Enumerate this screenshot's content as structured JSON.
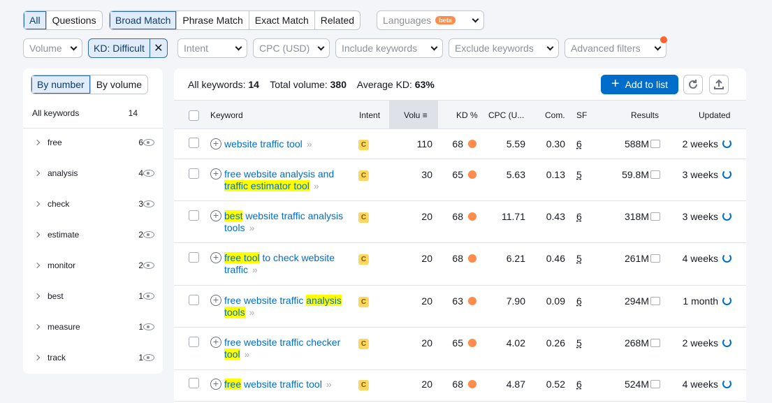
{
  "tabs_type": [
    "All",
    "Questions"
  ],
  "tabs_match": [
    "Broad Match",
    "Phrase Match",
    "Exact Match",
    "Related"
  ],
  "languages": {
    "label": "Languages",
    "badge": "beta"
  },
  "filters": {
    "volume": "Volume",
    "kd": "KD: Difficult",
    "intent": "Intent",
    "cpc": "CPC (USD)",
    "include": "Include keywords",
    "exclude": "Exclude keywords",
    "advanced": "Advanced filters"
  },
  "left": {
    "toggle": [
      "By number",
      "By volume"
    ],
    "all_label": "All keywords",
    "all_count": "14",
    "groups": [
      {
        "name": "free",
        "count": "6"
      },
      {
        "name": "analysis",
        "count": "4"
      },
      {
        "name": "check",
        "count": "3"
      },
      {
        "name": "estimate",
        "count": "2"
      },
      {
        "name": "monitor",
        "count": "2"
      },
      {
        "name": "best",
        "count": "1"
      },
      {
        "name": "measure",
        "count": "1"
      },
      {
        "name": "track",
        "count": "1"
      }
    ]
  },
  "summary": {
    "all_label": "All keywords:",
    "all_value": "14",
    "vol_label": "Total volume:",
    "vol_value": "380",
    "kd_label": "Average KD:",
    "kd_value": "63%"
  },
  "add_to_list": "Add to list",
  "columns": [
    "Keyword",
    "Intent",
    "Volu",
    "KD %",
    "CPC (U...",
    "Com.",
    "SF",
    "Results",
    "Updated"
  ],
  "rows": [
    {
      "kw": [
        [
          "website traffic tool",
          false
        ]
      ],
      "intent": "C",
      "volume": "110",
      "kd": "68",
      "cpc": "5.59",
      "com": "0.30",
      "sf": "6",
      "results": "588M",
      "updated": "2 weeks"
    },
    {
      "kw": [
        [
          "free website analysis and ",
          false
        ],
        [
          "traffic estimator tool",
          true
        ]
      ],
      "intent": "C",
      "volume": "30",
      "kd": "65",
      "cpc": "5.63",
      "com": "0.13",
      "sf": "5",
      "results": "59.8M",
      "updated": "3 weeks"
    },
    {
      "kw": [
        [
          "best",
          true
        ],
        [
          " website traffic analysis tools",
          false
        ]
      ],
      "intent": "C",
      "volume": "20",
      "kd": "68",
      "cpc": "11.71",
      "com": "0.43",
      "sf": "6",
      "results": "318M",
      "updated": "3 weeks"
    },
    {
      "kw": [
        [
          "free tool",
          true
        ],
        [
          " to check website traffic",
          false
        ]
      ],
      "intent": "C",
      "volume": "20",
      "kd": "68",
      "cpc": "6.21",
      "com": "0.46",
      "sf": "5",
      "results": "261M",
      "updated": "4 weeks"
    },
    {
      "kw": [
        [
          "free website traffic ",
          false
        ],
        [
          "analysis tools",
          true
        ]
      ],
      "intent": "C",
      "volume": "20",
      "kd": "63",
      "cpc": "7.90",
      "com": "0.09",
      "sf": "6",
      "results": "294M",
      "updated": "1 month"
    },
    {
      "kw": [
        [
          "free website traffic checker ",
          false
        ],
        [
          "tool",
          true
        ]
      ],
      "intent": "C",
      "volume": "20",
      "kd": "65",
      "cpc": "4.02",
      "com": "0.26",
      "sf": "5",
      "results": "268M",
      "updated": "2 weeks"
    },
    {
      "kw": [
        [
          "free",
          true
        ],
        [
          " website traffic tool",
          false
        ]
      ],
      "intent": "C",
      "volume": "20",
      "kd": "68",
      "cpc": "4.87",
      "com": "0.52",
      "sf": "6",
      "results": "524M",
      "updated": "4 weeks"
    }
  ]
}
